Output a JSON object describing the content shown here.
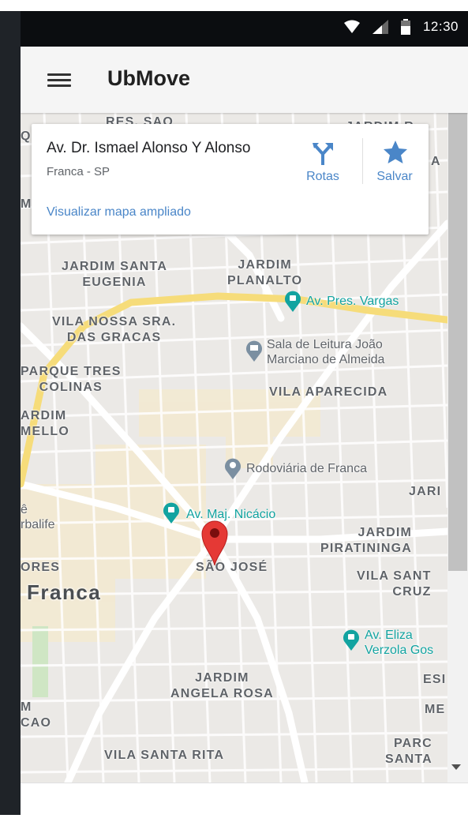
{
  "status_bar": {
    "time": "12:30",
    "icons": [
      "wifi-icon",
      "cell-signal-icon",
      "battery-icon"
    ]
  },
  "app_bar": {
    "title": "UbMove",
    "menu_icon": "hamburger-menu-icon"
  },
  "place_card": {
    "title": "Av. Dr. Ismael Alonso Y Alonso",
    "subtitle": "Franca - SP",
    "link": "Visualizar mapa ampliado",
    "directions_label": "Rotas",
    "save_label": "Salvar",
    "directions_icon": "directions-icon",
    "save_icon": "star-icon"
  },
  "map": {
    "labels": {
      "res_sao": "RES. SAO",
      "jardim_r": "JARDIM R.",
      "q": "Q",
      "a": "A",
      "m_left": "M",
      "jardim_santa_eugenia": "JARDIM SANTA\nEUGENIA",
      "jardim_planalto": "JARDIM\nPLANALTO",
      "vila_nossa_sra": "VILA NOSSA SRA.\nDAS GRACAS",
      "parque_tres_colinas": "PARQUE TRES\nCOLINAS",
      "vila_aparecida": "VILA APARECIDA",
      "ardim_mello": "ARDIM\nMELLO",
      "jari": "JARI",
      "jardim_piratininga": "JARDIM\nPIRATININGA",
      "sao_jose": "SÃO JOSÉ",
      "ores": "ORES",
      "vila_sant_cruz": "VILA SANT\nCRUZ",
      "esi": "ESI",
      "jardim_angela_rosa": "JARDIM\nANGELA ROSA",
      "me": "ME",
      "m_cao": "M\nCAO",
      "parc_santa": "PARC\nSANTA",
      "vila_santa_rita": "VILA SANTA RITA"
    },
    "pois": {
      "av_pres_vargas": "Av. Pres. Vargas",
      "sala_leitura": "Sala de Leitura João\nMarciano de Almeida",
      "rodoviaria": "Rodoviária de Franca",
      "av_maj_nicacio": "Av. Maj. Nicácio",
      "herbalife": "ê\nrbalife",
      "av_eliza": "Av. Eliza\nVerzola Gos"
    },
    "city": "Franca",
    "colors": {
      "background": "#ebe9e6",
      "road": "#ffffff",
      "highway": "#f6dc7a",
      "highlight_zone": "#f3ead2",
      "park": "#cfe6c4",
      "poi_teal": "#12a3a0",
      "pin": "#e53935"
    },
    "pin_icon": "map-pin-icon"
  },
  "scrollbar": {
    "down_icon": "scroll-down-arrow-icon"
  }
}
